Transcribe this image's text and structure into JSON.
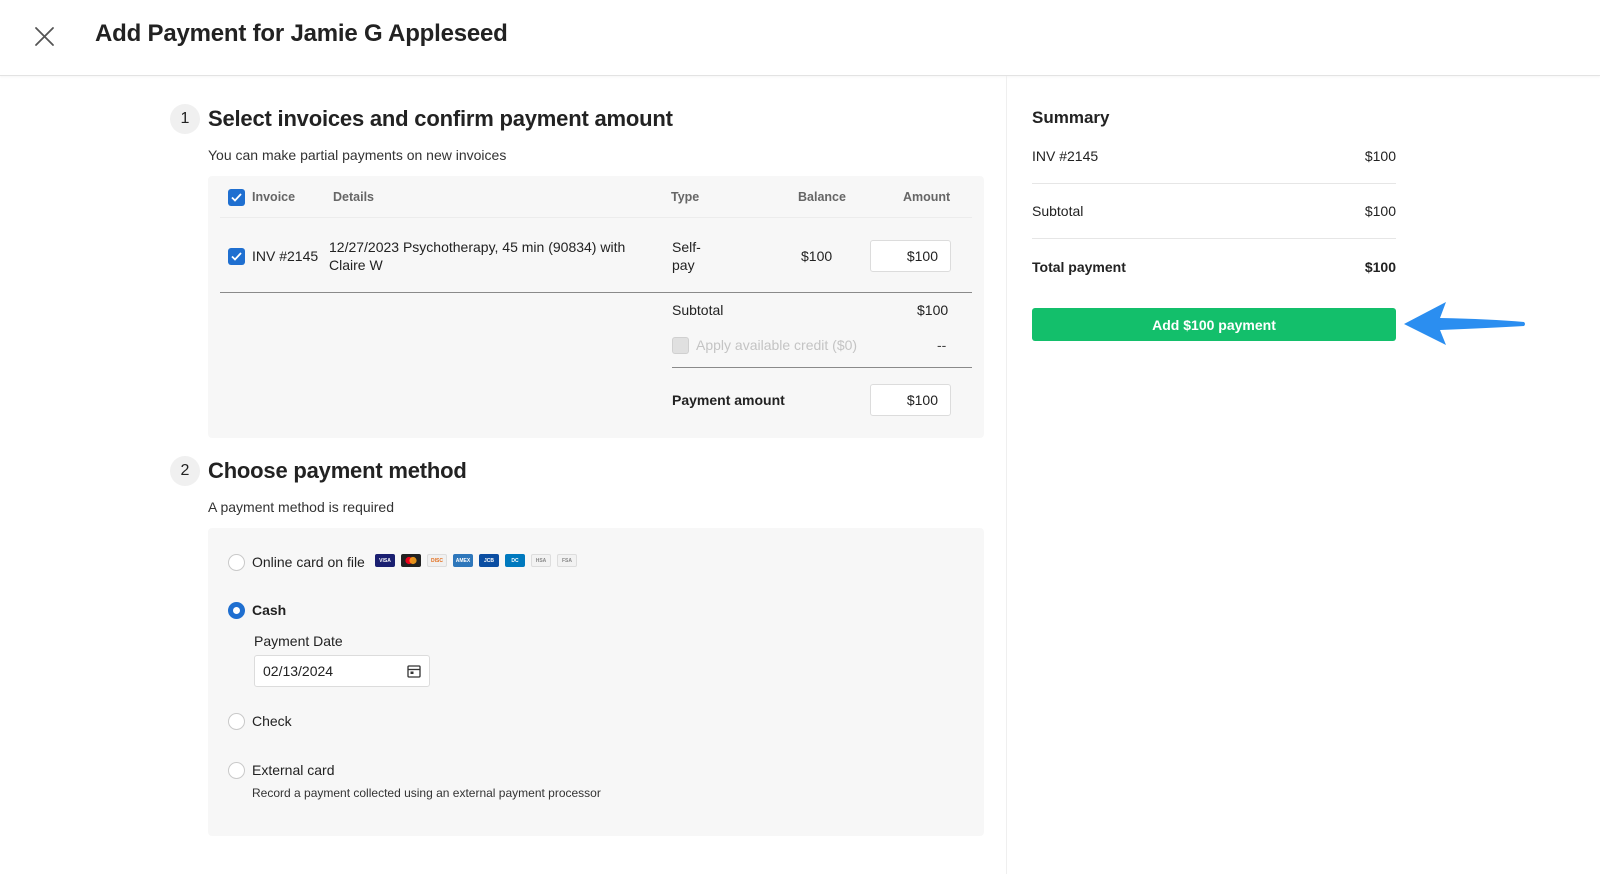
{
  "header": {
    "title": "Add Payment for Jamie G Appleseed"
  },
  "step1": {
    "number": "1",
    "title": "Select invoices and confirm payment amount",
    "subtitle": "You can make partial payments on new invoices",
    "table": {
      "headers": {
        "invoice": "Invoice",
        "details": "Details",
        "type": "Type",
        "balance": "Balance",
        "amount": "Amount"
      },
      "rows": [
        {
          "invoice": "INV #2145",
          "details_line1": "12/27/2023 Psychotherapy, 45 min (90834) with",
          "details_line2": "Claire W",
          "type_line1": "Self-",
          "type_line2": "pay",
          "balance": "$100",
          "amount": "$100",
          "checked": true
        }
      ],
      "subtotal_label": "Subtotal",
      "subtotal_value": "$100",
      "credit_label": "Apply available credit ($0)",
      "credit_value": "--",
      "payment_amount_label": "Payment amount",
      "payment_amount_value": "$100"
    }
  },
  "step2": {
    "number": "2",
    "title": "Choose payment method",
    "subtitle": "A payment method is required",
    "methods": [
      {
        "label": "Online card on file",
        "selected": false
      },
      {
        "label": "Cash",
        "selected": true
      },
      {
        "label": "Check",
        "selected": false
      },
      {
        "label": "External card",
        "selected": false,
        "description": "Record a payment collected using an external payment processor"
      }
    ],
    "card_icons": [
      {
        "name": "visa-icon",
        "text": "VISA",
        "color": "#1a1f71"
      },
      {
        "name": "mastercard-icon",
        "text": "",
        "color": "#222222"
      },
      {
        "name": "discover-icon",
        "text": "DISC",
        "color": "#f0f0f0"
      },
      {
        "name": "amex-icon",
        "text": "AMEX",
        "color": "#2e77bb"
      },
      {
        "name": "jcb-icon",
        "text": "JCB",
        "color": "#0b4ea2"
      },
      {
        "name": "diners-icon",
        "text": "DC",
        "color": "#0079be"
      },
      {
        "name": "hsa-icon",
        "text": "HSA",
        "color": "#f2f2f2"
      },
      {
        "name": "fsa-icon",
        "text": "FSA",
        "color": "#f2f2f2"
      }
    ],
    "payment_date_label": "Payment Date",
    "payment_date_value": "02/13/2024"
  },
  "summary": {
    "title": "Summary",
    "invoice_label": "INV #2145",
    "invoice_value": "$100",
    "subtotal_label": "Subtotal",
    "subtotal_value": "$100",
    "total_label": "Total payment",
    "total_value": "$100",
    "button_label": "Add $100 payment"
  },
  "colors": {
    "accent": "#1f6fd0",
    "button_green": "#13bf6b",
    "arrow_blue": "#2b8ef0"
  }
}
